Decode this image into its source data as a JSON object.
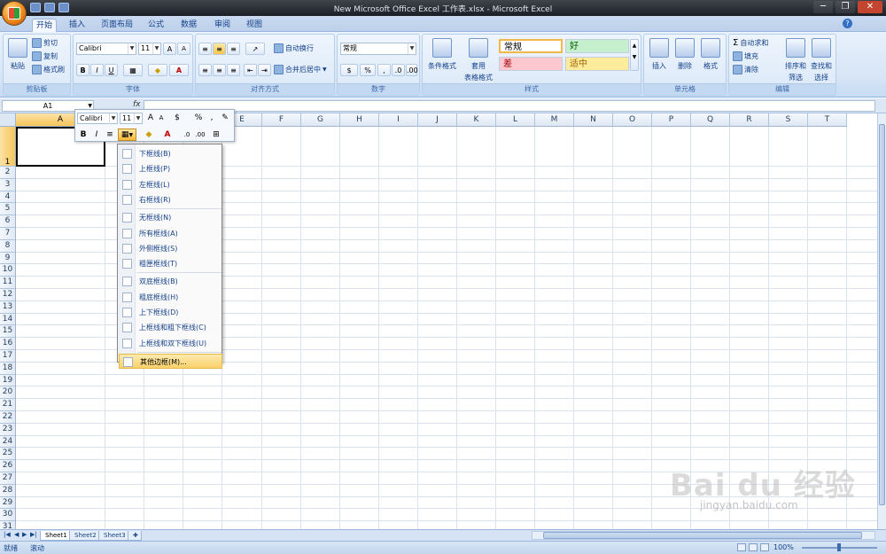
{
  "window": {
    "title": "New Microsoft Office Excel 工作表.xlsx - Microsoft Excel",
    "min": "─",
    "max": "❐",
    "close": "✕"
  },
  "tabs": [
    "开始",
    "插入",
    "页面布局",
    "公式",
    "数据",
    "审阅",
    "视图"
  ],
  "active_tab": "开始",
  "ribbon": {
    "clipboard": {
      "caption": "剪贴板",
      "paste": "粘贴",
      "cut": "剪切",
      "copy": "复制",
      "format_painter": "格式刷"
    },
    "font": {
      "caption": "字体",
      "name": "Calibri",
      "size": "11",
      "bold": "B",
      "italic": "I",
      "underline": "U",
      "grow": "A",
      "shrink": "A",
      "font_color": "A"
    },
    "alignment": {
      "caption": "对齐方式",
      "wrap": "自动换行",
      "merge": "合并后居中"
    },
    "number": {
      "caption": "数字",
      "format": "常规",
      "currency": "$",
      "percent": "%",
      "comma": ","
    },
    "styles": {
      "caption": "样式",
      "conditional": "条件格式",
      "table": "套用",
      "table2": "表格格式",
      "normal": "常规",
      "good": "好",
      "bad": "差",
      "neutral": "适中"
    },
    "cells": {
      "caption": "单元格",
      "insert": "插入",
      "delete": "删除",
      "format": "格式"
    },
    "editing": {
      "caption": "编辑",
      "autosum": "自动求和",
      "fill": "填充",
      "clear": "清除",
      "sort": "排序和",
      "sort2": "筛选",
      "find": "查找和",
      "find2": "选择"
    }
  },
  "formula_bar": {
    "name_box": "A1",
    "fx": "fx"
  },
  "mini_toolbar": {
    "font": "Calibri",
    "size": "11",
    "grow": "A",
    "shrink": "A",
    "currency": "$",
    "percent": "%",
    "comma": ",",
    "bold": "B",
    "italic": "I",
    "font_color": "A"
  },
  "columns": [
    "A",
    "B",
    "C",
    "D",
    "E",
    "F",
    "G",
    "H",
    "I",
    "J",
    "K",
    "L",
    "M",
    "N",
    "O",
    "P",
    "Q",
    "R",
    "S",
    "T"
  ],
  "rows": [
    "1",
    "2",
    "3",
    "4",
    "5",
    "6",
    "7",
    "8",
    "9",
    "10",
    "11",
    "12",
    "13",
    "14",
    "15",
    "16",
    "17",
    "18",
    "19",
    "20",
    "21",
    "22",
    "23",
    "24",
    "25",
    "26",
    "27",
    "28",
    "29",
    "30",
    "31"
  ],
  "border_menu": [
    {
      "label": "下框线(B)",
      "group": 1
    },
    {
      "label": "上框线(P)",
      "group": 1
    },
    {
      "label": "左框线(L)",
      "group": 1
    },
    {
      "label": "右框线(R)",
      "group": 1
    },
    {
      "label": "无框线(N)",
      "group": 2
    },
    {
      "label": "所有框线(A)",
      "group": 2
    },
    {
      "label": "外侧框线(S)",
      "group": 2
    },
    {
      "label": "粗匣框线(T)",
      "group": 2
    },
    {
      "label": "双底框线(B)",
      "group": 3
    },
    {
      "label": "粗底框线(H)",
      "group": 3
    },
    {
      "label": "上下框线(D)",
      "group": 3
    },
    {
      "label": "上框线和粗下框线(C)",
      "group": 3
    },
    {
      "label": "上框线和双下框线(U)",
      "group": 3
    },
    {
      "label": "其他边框(M)...",
      "group": 4,
      "highlighted": true
    }
  ],
  "sheets": [
    "Sheet1",
    "Sheet2",
    "Sheet3"
  ],
  "active_sheet": "Sheet1",
  "status": {
    "ready": "就绪",
    "mode": "滚动",
    "zoom": "100%"
  },
  "watermark": {
    "main": "Bai du 经验",
    "sub": "jingyan.baidu.com"
  }
}
